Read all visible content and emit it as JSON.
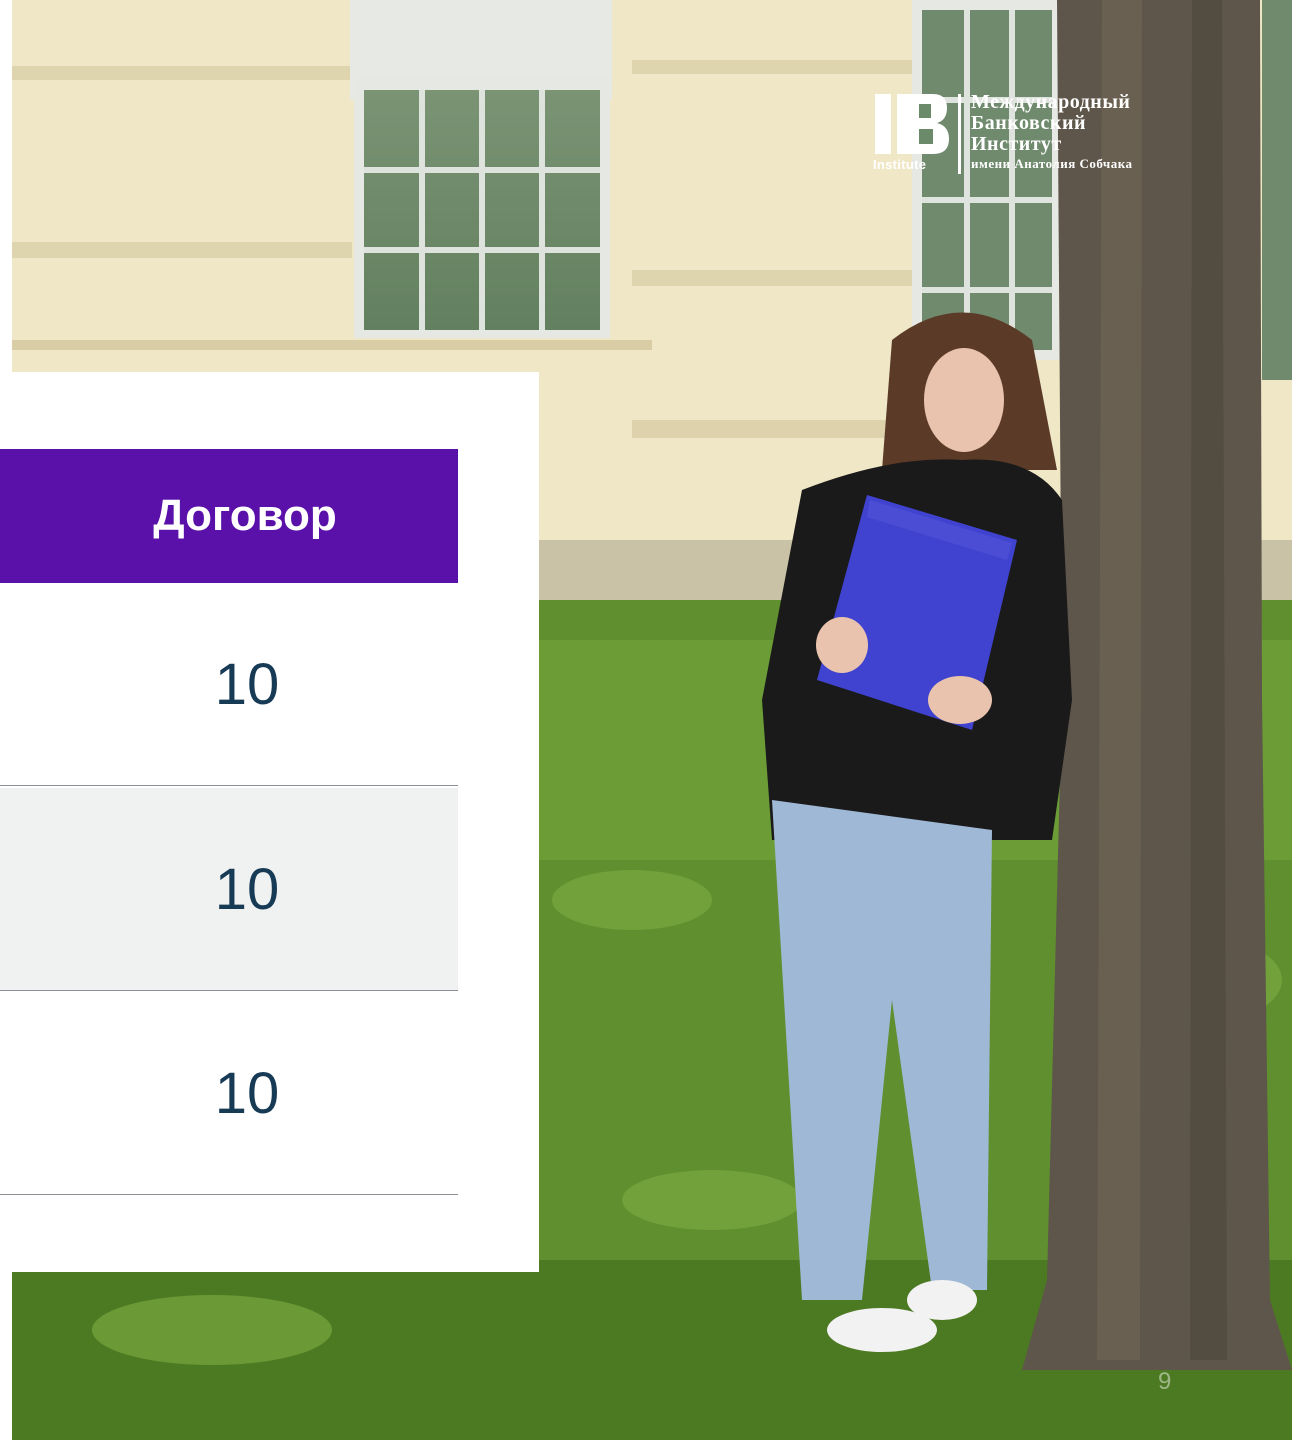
{
  "logo": {
    "mark_sub": "Institute",
    "line1": "Международный",
    "line2": "Банковский",
    "line3": "Институт",
    "line4": "имени Анатолия Собчака"
  },
  "table": {
    "header": "Договор",
    "rows": [
      "10",
      "10",
      "10"
    ]
  },
  "page_number": "9",
  "colors": {
    "header_bg": "#5a11a9",
    "row_alt_bg": "#f0f1f1",
    "value_text": "#173a55"
  }
}
